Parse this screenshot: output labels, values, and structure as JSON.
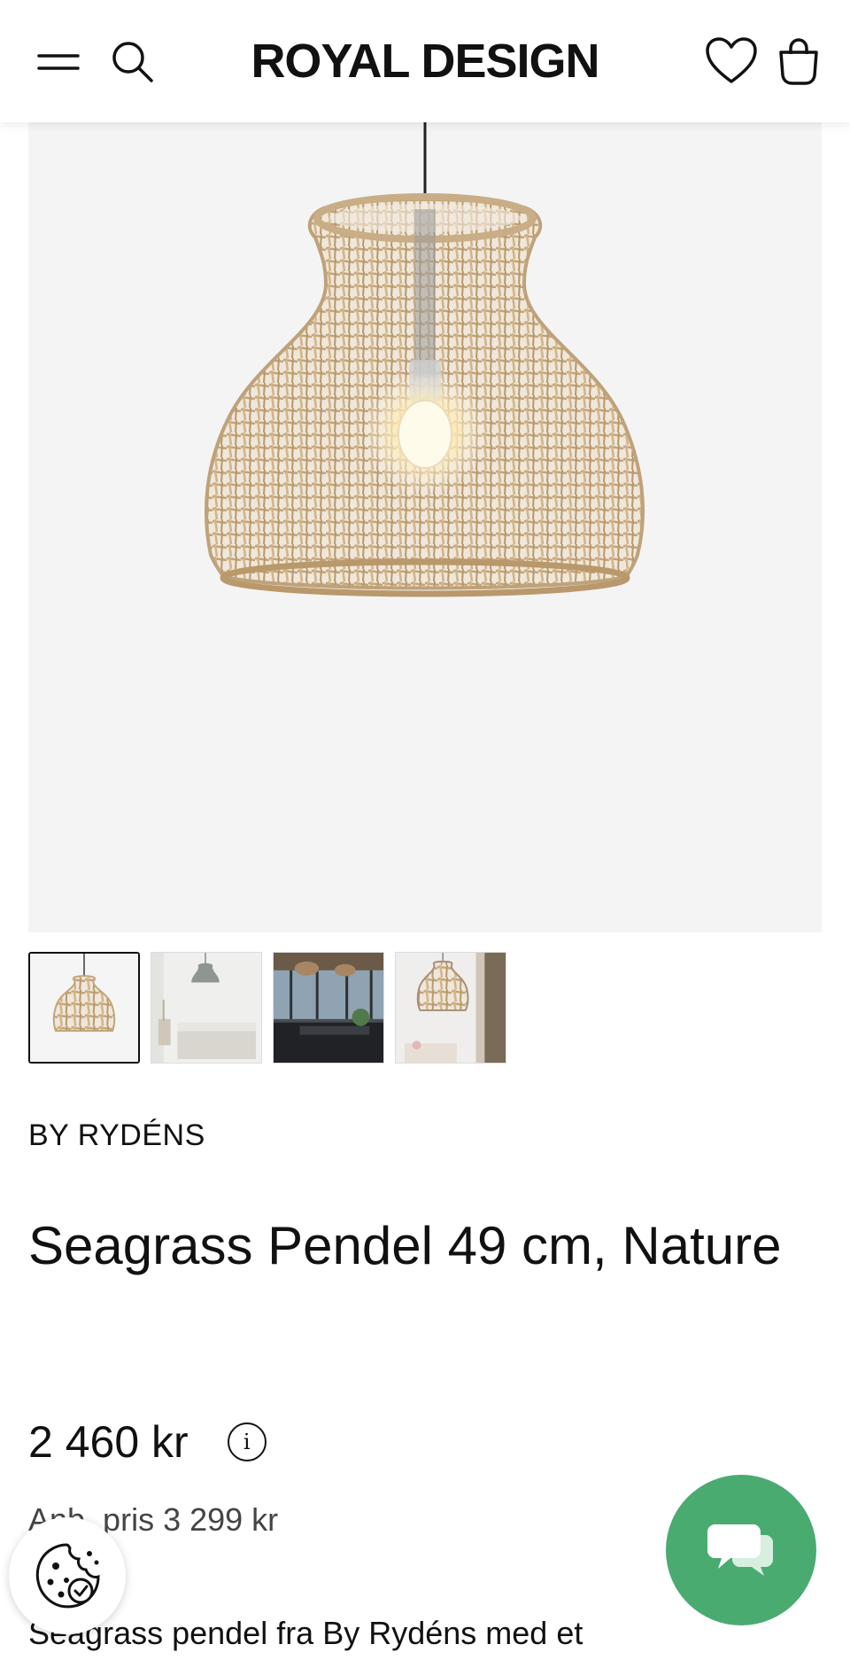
{
  "header": {
    "logo": "ROYAL DESIGN",
    "icons": {
      "menu": "menu-icon",
      "search": "search-icon",
      "wishlist": "heart-icon",
      "cart": "shopping-bag-icon"
    }
  },
  "product": {
    "brand": "BY RYDÉNS",
    "title": "Seagrass Pendel 49 cm, Nature",
    "price": "2 460 kr",
    "recommended_price": "Anb. pris 3 299 kr",
    "description": "Seagrass pendel fra By Rydéns med et",
    "thumbnails": [
      {
        "name": "thumbnail-1",
        "active": true
      },
      {
        "name": "thumbnail-2",
        "active": false
      },
      {
        "name": "thumbnail-3",
        "active": false
      },
      {
        "name": "thumbnail-4",
        "active": false
      }
    ]
  },
  "colors": {
    "chat_green": "#4aab70",
    "image_background": "#f4f4f4",
    "lamp_rattan": "#c9b18b"
  }
}
